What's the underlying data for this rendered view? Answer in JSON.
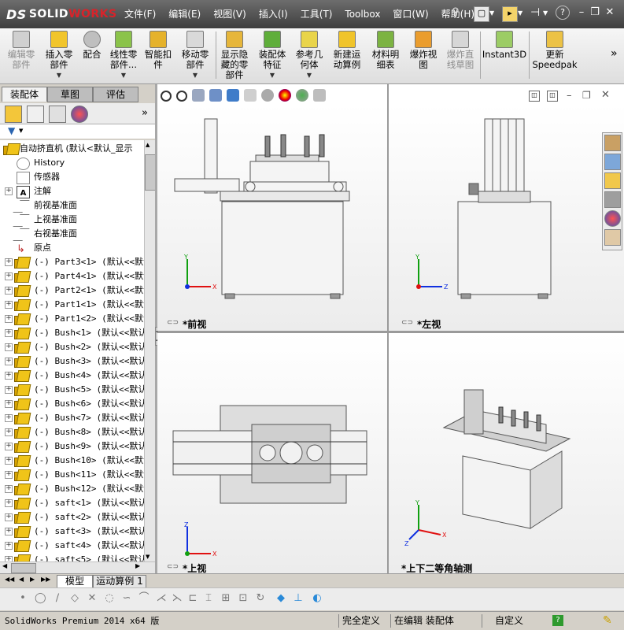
{
  "app": {
    "logo_prefix": "DS",
    "logo_text": "SOLID",
    "logo_text2": "WORKS"
  },
  "menu": [
    "文件(F)",
    "编辑(E)",
    "视图(V)",
    "插入(I)",
    "工具(T)",
    "Toolbox",
    "窗口(W)",
    "帮助(H)"
  ],
  "commands": [
    {
      "label": "编辑零\n部件",
      "enabled": false,
      "icon": "edit-component-icon"
    },
    {
      "label": "插入零\n部件",
      "enabled": true,
      "icon": "insert-component-icon",
      "dropdown": true
    },
    {
      "label": "配合",
      "enabled": true,
      "icon": "mate-icon"
    },
    {
      "label": "线性零\n部件...",
      "enabled": true,
      "icon": "linear-pattern-icon",
      "dropdown": true
    },
    {
      "label": "智能扣\n件",
      "enabled": true,
      "icon": "smart-fastener-icon"
    },
    {
      "label": "移动零\n部件",
      "enabled": true,
      "icon": "move-component-icon",
      "dropdown": true
    },
    {
      "label": "显示隐\n藏的零\n部件",
      "enabled": true,
      "icon": "show-hidden-icon"
    },
    {
      "label": "装配体\n特征",
      "enabled": true,
      "icon": "assembly-feature-icon",
      "dropdown": true
    },
    {
      "label": "参考几\n何体",
      "enabled": true,
      "icon": "reference-geometry-icon",
      "dropdown": true
    },
    {
      "label": "新建运\n动算例",
      "enabled": true,
      "icon": "motion-study-icon"
    },
    {
      "label": "材料明\n细表",
      "enabled": true,
      "icon": "bom-icon"
    },
    {
      "label": "爆炸视\n图",
      "enabled": true,
      "icon": "exploded-view-icon"
    },
    {
      "label": "爆炸直\n线草图",
      "enabled": false,
      "icon": "explode-line-icon"
    },
    {
      "label": "Instant3D",
      "enabled": true,
      "icon": "instant3d-icon"
    },
    {
      "label": "更新\nSpeedpak",
      "enabled": true,
      "icon": "speedpak-icon"
    }
  ],
  "left_tabs": [
    "装配体",
    "草图",
    "评估"
  ],
  "tree": {
    "root": "自动挤直机  (默认<默认_显示",
    "items": [
      {
        "label": "History",
        "type": "history"
      },
      {
        "label": "传感器",
        "type": "sensor"
      },
      {
        "label": "注解",
        "type": "annotation",
        "expand": true
      },
      {
        "label": "前视基准面",
        "type": "plane"
      },
      {
        "label": "上视基准面",
        "type": "plane"
      },
      {
        "label": "右视基准面",
        "type": "plane"
      },
      {
        "label": "原点",
        "type": "origin"
      },
      {
        "label": "(-) Part3<1> (默认<<默认",
        "type": "component"
      },
      {
        "label": "(-) Part4<1> (默认<<默认",
        "type": "component"
      },
      {
        "label": "(-) Part2<1> (默认<<默认",
        "type": "component"
      },
      {
        "label": "(-) Part1<1> (默认<<默认",
        "type": "component"
      },
      {
        "label": "(-) Part1<2> (默认<<默认",
        "type": "component"
      },
      {
        "label": "(-) Bush<1>  (默认<<默认",
        "type": "component"
      },
      {
        "label": "(-) Bush<2>  (默认<<默认",
        "type": "component"
      },
      {
        "label": "(-) Bush<3>  (默认<<默认",
        "type": "component"
      },
      {
        "label": "(-) Bush<4>  (默认<<默认",
        "type": "component"
      },
      {
        "label": "(-) Bush<5>  (默认<<默认",
        "type": "component"
      },
      {
        "label": "(-) Bush<6>  (默认<<默认",
        "type": "component"
      },
      {
        "label": "(-) Bush<7>  (默认<<默认",
        "type": "component"
      },
      {
        "label": "(-) Bush<8>  (默认<<默认",
        "type": "component"
      },
      {
        "label": "(-) Bush<9>  (默认<<默认",
        "type": "component"
      },
      {
        "label": "(-) Bush<10> (默认<<默认",
        "type": "component"
      },
      {
        "label": "(-) Bush<11> (默认<<默认",
        "type": "component"
      },
      {
        "label": "(-) Bush<12> (默认<<默认",
        "type": "component"
      },
      {
        "label": "(-) saft<1>  (默认<<默认",
        "type": "component"
      },
      {
        "label": "(-) saft<2>  (默认<<默认",
        "type": "component"
      },
      {
        "label": "(-) saft<3>  (默认<<默认",
        "type": "component"
      },
      {
        "label": "(-) saft<4>  (默认<<默认",
        "type": "component"
      },
      {
        "label": "(-) saft<5>  (默认<<默认",
        "type": "component"
      }
    ]
  },
  "viewports": {
    "front": "*前视",
    "left": "*左视",
    "top": "*上视",
    "iso": "*上下二等角轴测"
  },
  "bottom_tabs": [
    "模型",
    "运动算例 1"
  ],
  "status": {
    "product": "SolidWorks Premium 2014 x64 版",
    "definition": "完全定义",
    "editing": "在编辑 装配体",
    "custom": "自定义",
    "help": "?"
  },
  "colors": {
    "titlebar": "#4a4a4a",
    "accent_red": "#d8232a",
    "axis_x": "#e01010",
    "axis_y": "#10a010",
    "axis_z": "#1030e0"
  }
}
